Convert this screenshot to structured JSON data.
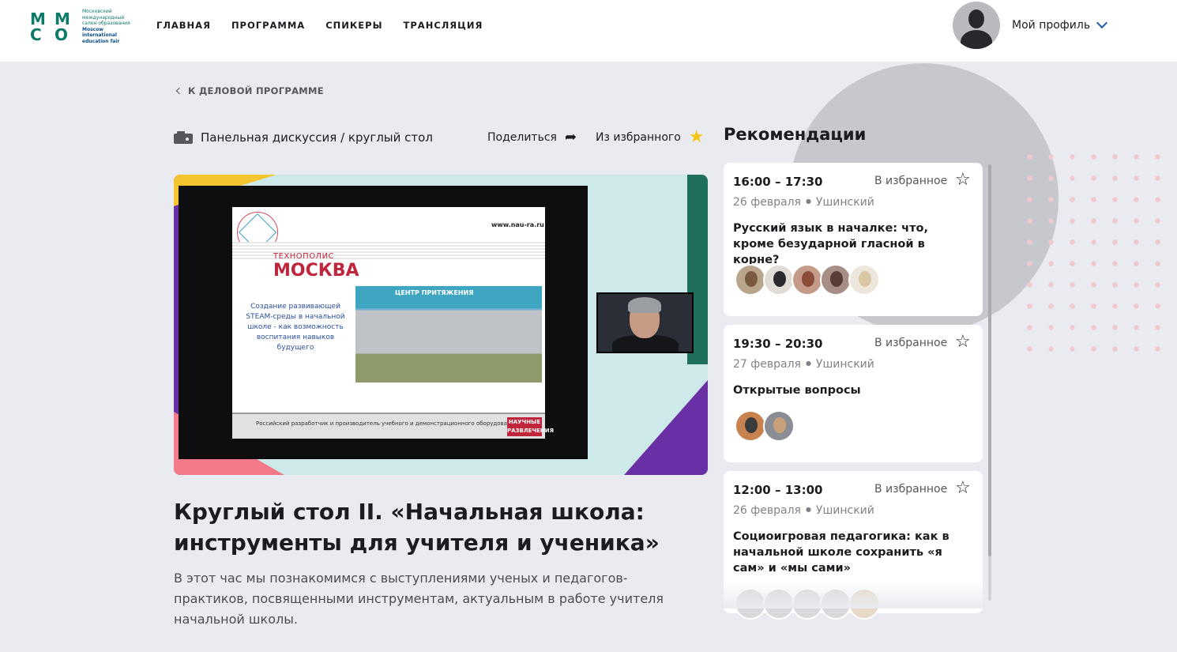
{
  "header": {
    "logo": {
      "mark": [
        "М",
        "М",
        "С",
        "О"
      ],
      "text_ru": [
        "Московский",
        "международный",
        "салон образования"
      ],
      "text_en": [
        "Moscow international",
        "education fair"
      ]
    },
    "nav": [
      "ГЛАВНАЯ",
      "ПРОГРАММА",
      "СПИКЕРЫ",
      "ТРАНСЛЯЦИЯ"
    ],
    "profile_label": "Мой профиль"
  },
  "back_label": "К ДЕЛОВОЙ ПРОГРАММЕ",
  "event": {
    "type": "Панельная дискуссия / круглый стол",
    "share_label": "Поделиться",
    "fav_label": "Из избранного",
    "title": "Круглый стол II. «Начальная школа: инструменты для учителя и ученика»",
    "description": "В этот час мы познакомимся с выступлениями ученых и педагогов-практиков, посвященными инструментам, актуальным в работе учителя начальной школы."
  },
  "slide": {
    "url": "www.nau-ra.ru",
    "t1": "ТЕХНОПОЛИС",
    "t2": "МОСКВА",
    "desc": "Создание развивающей STEAM-среды в начальной школе - как возможность воспитания навыков будущего",
    "photo_caption": "ЦЕНТР ПРИТЯЖЕНИЯ",
    "footer": "Российский разработчик и производитель учебного и демонстрационного оборудования",
    "footer_logo": "НАУЧНЫЕ РАЗВЛЕЧЕНИЯ"
  },
  "recommendations": {
    "title": "Рекомендации",
    "fav_label": "В избранное",
    "items": [
      {
        "time": "16:00 – 17:30",
        "date": "26 февраля",
        "place": "Ушинский",
        "name": "Русский язык в началке: что, кроме безударной гласной в корне?",
        "speakers": [
          "#7a5a3e",
          "#2b2b2e",
          "#8b4c3a",
          "#5a3d35",
          "#d9c7a4"
        ]
      },
      {
        "time": "19:30 – 20:30",
        "date": "27 февраля",
        "place": "Ушинский",
        "name": "Открытые вопросы",
        "speakers": [
          "#3b3a3c",
          "#c9a07a"
        ]
      },
      {
        "time": "12:00 – 13:00",
        "date": "26 февраля",
        "place": "Ушинский",
        "name": "Социоигровая педагогика: как в начальной школе сохранить «я сам» и «мы сами»",
        "speakers": [
          "#d9d9dc",
          "#d9d9dc",
          "#d9d9dc",
          "#d9d9dc",
          "#e6d9c7"
        ]
      }
    ]
  },
  "colors": {
    "brand_green": "#0c7a68",
    "accent_blue": "#1b5fb0",
    "star_gold": "#f5c518",
    "background": "#e9ebf0"
  }
}
